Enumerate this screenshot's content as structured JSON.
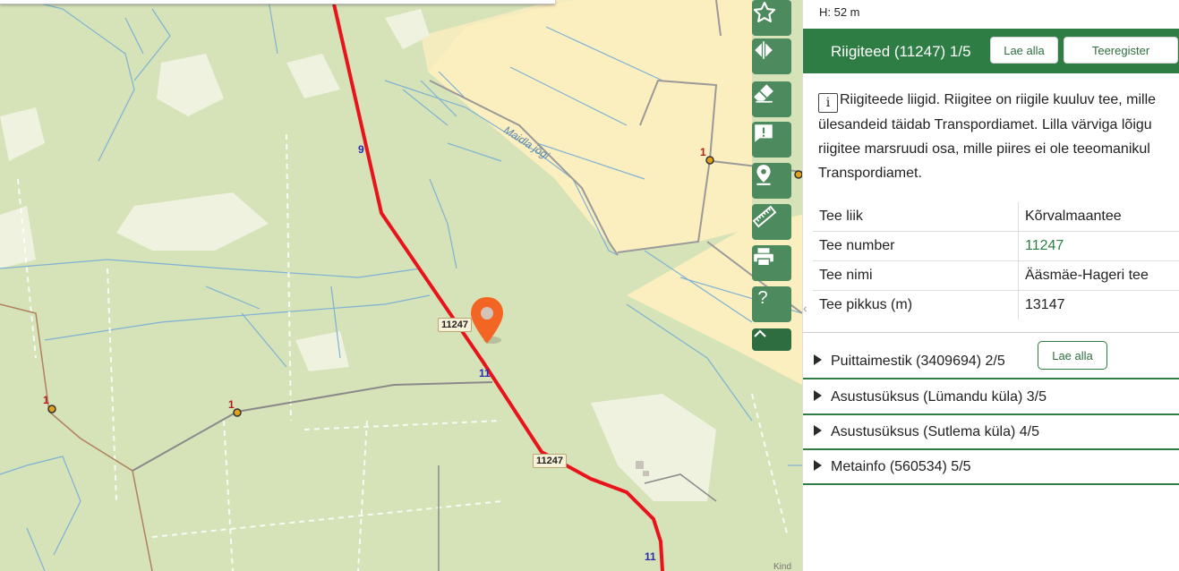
{
  "map": {
    "road_labels": [
      "11247",
      "11247",
      "11"
    ],
    "road_numbers": [
      "9",
      "1",
      "1",
      "1",
      "1",
      "1"
    ],
    "river_name": "Maidla jõgi",
    "scale_text": "Kind",
    "marker_icon": "location-pin-icon"
  },
  "toolbar": {
    "buttons": [
      {
        "name": "favorite-button",
        "icon": "star-icon"
      },
      {
        "name": "compare-button",
        "icon": "split-arrows-icon"
      },
      {
        "name": "clear-button",
        "icon": "eraser-icon"
      },
      {
        "name": "feedback-button",
        "icon": "comment-exclamation-icon"
      },
      {
        "name": "location-button",
        "icon": "location-pin-icon"
      },
      {
        "name": "measure-button",
        "icon": "ruler-icon"
      },
      {
        "name": "print-button",
        "icon": "printer-icon"
      },
      {
        "name": "help-button",
        "icon": "question-icon"
      }
    ],
    "collapse_icon": "chevron-up-icon"
  },
  "panel": {
    "coordinate": "H: 52 m",
    "active_section": {
      "title": "Riigiteed (11247) 1/5",
      "download_label": "Lae alla",
      "register_label": "Teeregister"
    },
    "info_icon_text": "i",
    "info_lines": [
      "Riigiteede liigid. Riigitee on riigile kuuluv tee, mille",
      "ülesandeid täidab Transpordiamet. Lilla värviga lõigu",
      "riigitee marsruudi osa, mille piires ei ole teeomanikul",
      "Transpordiamet."
    ],
    "properties": [
      {
        "key": "Tee liik",
        "value": "Kõrvalmaantee"
      },
      {
        "key": "Tee number",
        "value": "11247"
      },
      {
        "key": "Tee nimi",
        "value": "Ääsmäe-Hageri tee"
      },
      {
        "key": "Tee pikkus (m)",
        "value": "13147"
      }
    ],
    "sections": [
      {
        "title": "Puittaimestik (3409694) 2/5",
        "button": "Lae alla"
      },
      {
        "title": "Asustusüksus (Lümandu küla) 3/5"
      },
      {
        "title": "Asustusüksus (Sutlema küla) 4/5"
      },
      {
        "title": "Metainfo (560534) 5/5"
      }
    ]
  },
  "colors": {
    "accent_green": "#2e7d45",
    "tool_green": "#4d8a5e",
    "road_red": "#e8131b",
    "marker_orange": "#f26522",
    "forest": "#d6e2b8",
    "field": "#fbeebf"
  }
}
